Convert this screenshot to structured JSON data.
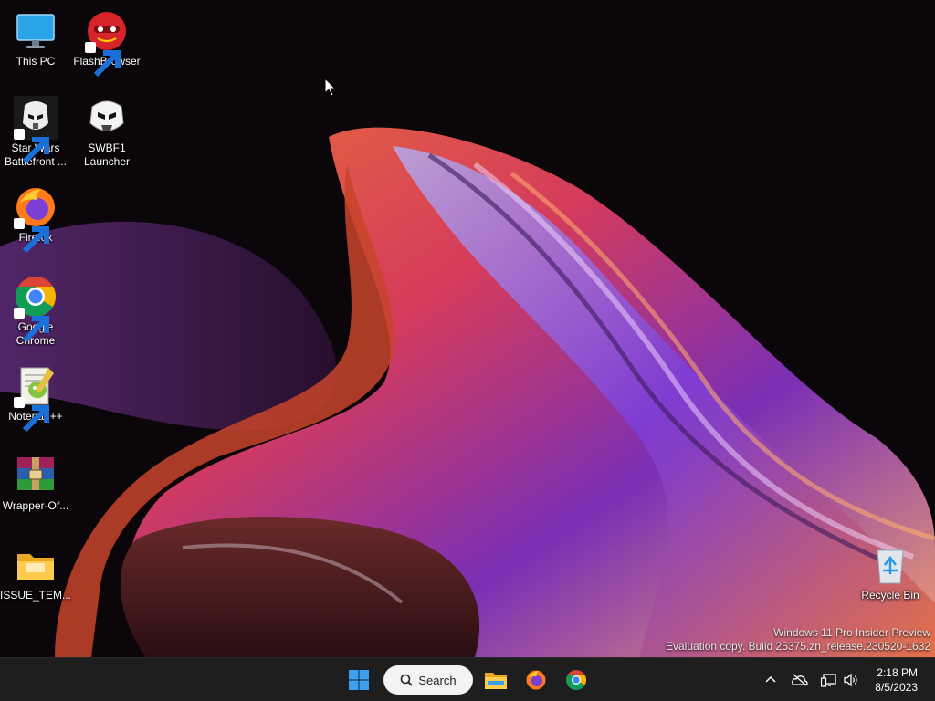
{
  "desktop": {
    "icons": [
      {
        "label": "This PC",
        "icon": "monitor-icon"
      },
      {
        "label": "FlashBrowser",
        "icon": "flash-mask-icon"
      },
      {
        "label": "Star Wars\nBattlefront ...",
        "icon": "stormtrooper-icon"
      },
      {
        "label": "SWBF1\nLauncher",
        "icon": "stormtrooper-helmet-icon"
      },
      {
        "label": "Firefox",
        "icon": "firefox-icon"
      },
      {
        "label": "Google\nChrome",
        "icon": "chrome-icon"
      },
      {
        "label": "Notepad++",
        "icon": "notepad-plus-plus-icon"
      },
      {
        "label": "Wrapper-Of...",
        "icon": "winrar-archive-icon"
      },
      {
        "label": "ISSUE_TEM...",
        "icon": "folder-icon"
      },
      {
        "label": "Recycle Bin",
        "icon": "recycle-bin-icon"
      }
    ],
    "watermark": {
      "line1": "Windows 11 Pro Insider Preview",
      "line2": "Evaluation copy. Build 25375.zn_release.230520-1632"
    }
  },
  "taskbar": {
    "search_label": "Search",
    "pinned": [
      "start-icon",
      "file-explorer-icon",
      "firefox-icon",
      "chrome-icon"
    ],
    "tray": [
      "chevron-up-icon",
      "onedrive-offline-icon",
      "network-icon",
      "volume-icon"
    ],
    "clock": {
      "time": "2:18 PM",
      "date": "8/5/2023"
    }
  },
  "colors": {
    "taskbar": "#1e1e1f",
    "desktop_bg": "#0b0609",
    "win_blue": "#3aa0f3"
  }
}
